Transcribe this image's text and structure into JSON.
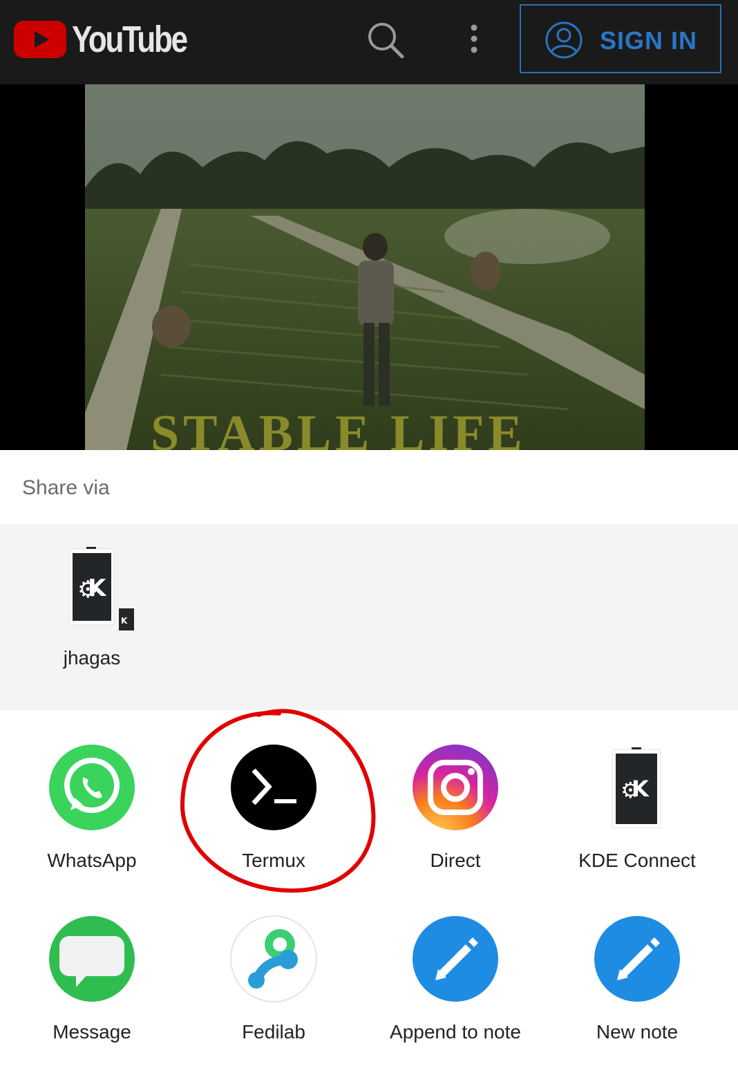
{
  "header": {
    "brand": "YouTube",
    "signin_label": "SIGN IN",
    "icons": [
      "youtube-play-icon",
      "search-icon",
      "more-vert-icon",
      "account-circle-icon"
    ],
    "brand_color": "#cc0000",
    "signin_color": "#2a76c6"
  },
  "video": {
    "caption_text": "STABLE LIFE"
  },
  "share": {
    "title": "Share via",
    "direct_targets": [
      {
        "label": "jhagas",
        "icon": "kde-connect-icon"
      }
    ],
    "apps": [
      {
        "label": "WhatsApp",
        "icon": "whatsapp-icon",
        "color": "#3ad35c"
      },
      {
        "label": "Termux",
        "icon": "termux-icon",
        "color": "#000000"
      },
      {
        "label": "Direct",
        "icon": "instagram-icon",
        "color": "#d6249f"
      },
      {
        "label": "KDE Connect",
        "icon": "kde-connect-icon",
        "color": "#232629"
      },
      {
        "label": "Message",
        "icon": "message-icon",
        "color": "#2fbd4f"
      },
      {
        "label": "Fedilab",
        "icon": "fedilab-icon",
        "color": "#2a9dd8"
      },
      {
        "label": "Append to note",
        "icon": "pencil-icon",
        "color": "#1e8ce3"
      },
      {
        "label": "New note",
        "icon": "pencil-icon",
        "color": "#1e8ce3"
      }
    ],
    "highlight_color": "#e00000"
  }
}
